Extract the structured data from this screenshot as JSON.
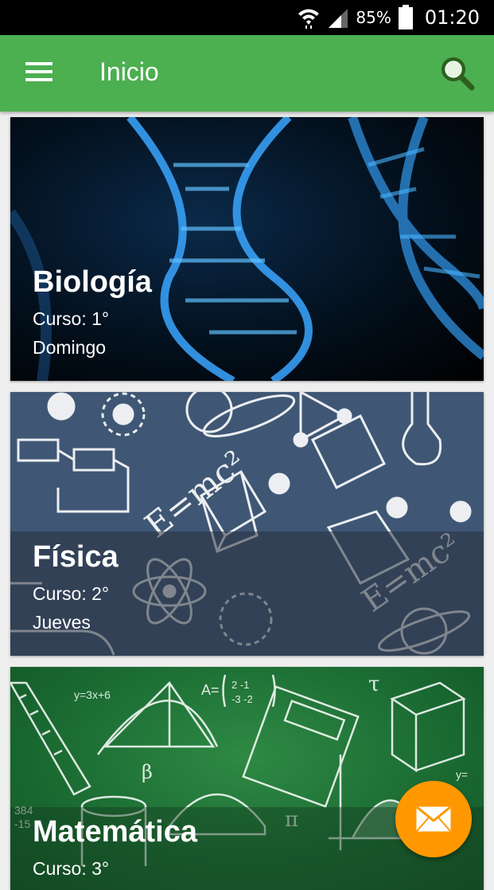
{
  "status_bar": {
    "battery": "85%",
    "time": "01:20"
  },
  "app_bar": {
    "title": "Inicio",
    "icons": [
      "menu-icon",
      "search-icon"
    ]
  },
  "courses": [
    {
      "title": "Biología",
      "course_line": "Curso:  1°",
      "day": "Domingo"
    },
    {
      "title": "Física",
      "course_line": "Curso:  2°",
      "day": "Jueves"
    },
    {
      "title": "Matemática",
      "course_line": "Curso:  3°"
    }
  ],
  "fab": {
    "icon": "mail-icon"
  },
  "colors": {
    "primary": "#4caf50",
    "accent": "#ff9800",
    "status_bar": "#000000"
  }
}
